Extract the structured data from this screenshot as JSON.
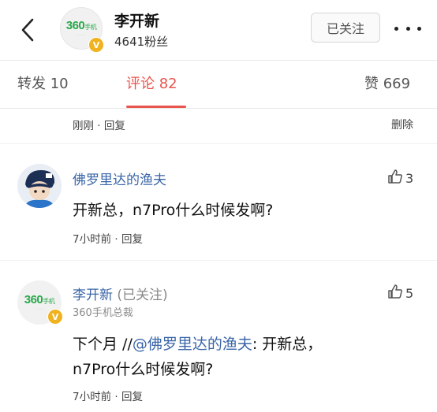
{
  "header": {
    "back_icon": "chevron-left-icon",
    "avatar_text": "360手机",
    "name": "李开新",
    "fans": "4641粉丝",
    "follow_label": "已关注",
    "more_icon": "more-dots-icon",
    "verified_mark": "V"
  },
  "tabs": [
    {
      "label": "转发 10"
    },
    {
      "label": "评论 82"
    },
    {
      "label": "赞 669"
    }
  ],
  "prev_comment": {
    "meta": "刚刚 · 回复",
    "delete_label": "删除"
  },
  "comments": [
    {
      "name": "佛罗里达的渔夫",
      "text": "开新总，n7Pro什么时候发啊?",
      "meta": "7小时前 · 回复",
      "likes": "3"
    },
    {
      "name": "李开新",
      "name_suffix": "(已关注)",
      "subtitle": "360手机总裁",
      "text_prefix": "下个月 //",
      "mention": "@佛罗里达的渔夫",
      "text_suffix": ": 开新总，",
      "text_line2": "n7Pro什么时候发啊?",
      "meta": "7小时前 · 回复",
      "likes": "5"
    }
  ],
  "colors": {
    "accent": "#e8554e",
    "link": "#3a66a8",
    "brand_green": "#2aa84a",
    "verified": "#f0b21e"
  }
}
